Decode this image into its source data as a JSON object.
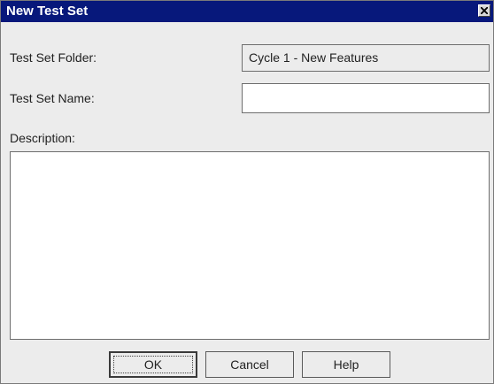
{
  "window": {
    "title": "New Test Set",
    "titlebar_color": "#07187b",
    "close_icon": "close-icon"
  },
  "form": {
    "folder_label": "Test Set Folder:",
    "folder_value": "Cycle 1 - New Features",
    "name_label": "Test Set Name:",
    "name_value": "",
    "description_label": "Description:",
    "description_value": ""
  },
  "buttons": {
    "ok": "OK",
    "cancel": "Cancel",
    "help": "Help"
  }
}
